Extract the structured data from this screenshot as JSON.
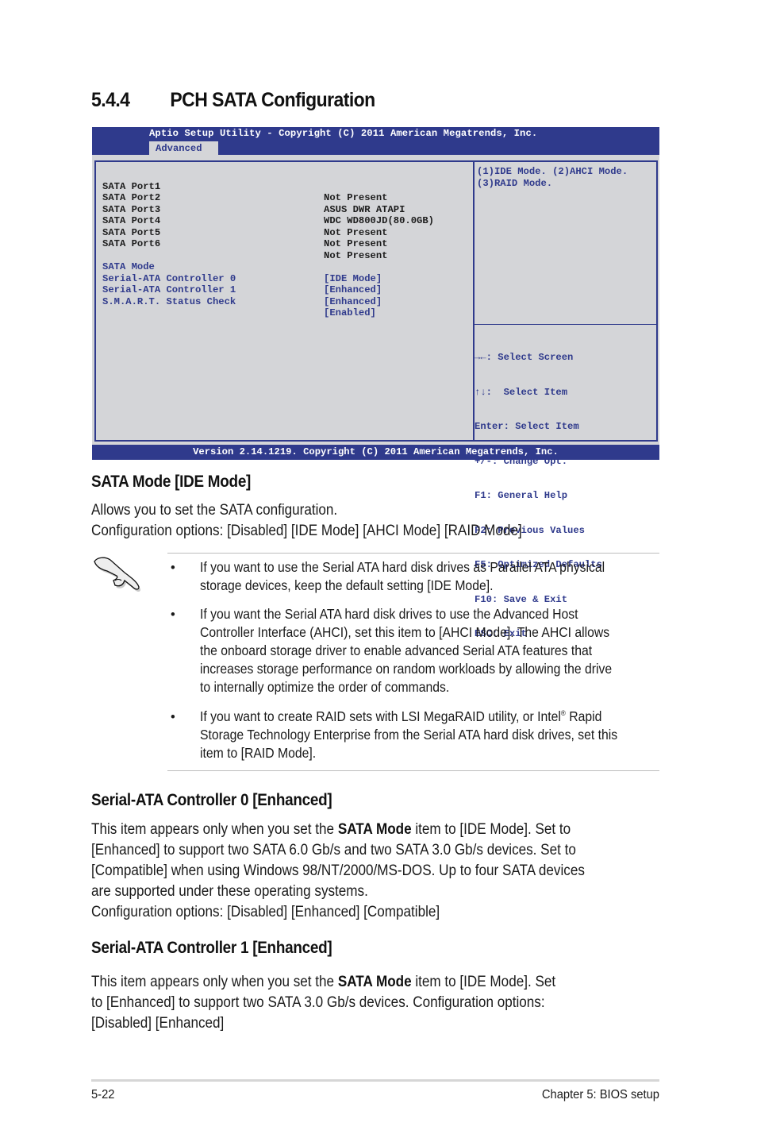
{
  "section": {
    "number": "5.4.4",
    "title": "PCH SATA Configuration"
  },
  "bios": {
    "title": "Aptio Setup Utility - Copyright (C) 2011 American Megatrends, Inc.",
    "active_tab": "Advanced",
    "info_rows": [
      {
        "label": "SATA Port1",
        "value": "Not Present"
      },
      {
        "label": "SATA Port2",
        "value": "ASUS DWR ATAPI"
      },
      {
        "label": "SATA Port3",
        "value": "WDC WD800JD(80.0GB)"
      },
      {
        "label": "SATA Port4",
        "value": "Not Present"
      },
      {
        "label": "SATA Port5",
        "value": "Not Present"
      },
      {
        "label": "SATA Port6",
        "value": "Not Present"
      }
    ],
    "config_rows": [
      {
        "label": "SATA Mode",
        "value": "[IDE Mode]"
      },
      {
        "label": "Serial-ATA Controller 0",
        "value": "[Enhanced]"
      },
      {
        "label": "Serial-ATA Controller 1",
        "value": "[Enhanced]"
      },
      {
        "label": "S.M.A.R.T. Status Check",
        "value": "[Enabled]"
      }
    ],
    "help_text": [
      "(1)IDE Mode. (2)AHCI Mode.",
      "(3)RAID Mode."
    ],
    "key_help": [
      "→←: Select Screen",
      "↑↓:  Select Item",
      "Enter: Select Item",
      "+/-: Change Opt.",
      "F1: General Help",
      "F2: Previous Values",
      "F5: Optimized Defaults",
      "F10: Save & Exit",
      "ESC: Exit"
    ],
    "footer": "Version 2.14.1219. Copyright (C) 2011 American Megatrends, Inc.",
    "colors": {
      "header_blue": "#2f3a8c",
      "panel_gray": "#d4d5d8",
      "info_text": "#1c1c1c"
    }
  },
  "sata_mode": {
    "heading": "SATA Mode [IDE Mode]",
    "lines": [
      "Allows you to set the SATA configuration.",
      "Configuration options: [Disabled] [IDE Mode] [AHCI Mode] [RAID Mode]"
    ]
  },
  "note": {
    "icon": "pointing-hand-icon",
    "bullet_char": "•",
    "bullets": [
      {
        "lines": [
          "If you want to use the Serial ATA hard disk drives as Parallel ATA physical",
          "storage devices, keep the default setting [IDE Mode]."
        ]
      },
      {
        "lines": [
          "If you want the Serial ATA hard disk drives to use the Advanced Host",
          "Controller Interface (AHCI), set this item to [AHCI Mode]. The AHCI allows",
          "the onboard storage driver to enable advanced Serial ATA features that",
          "increases storage performance on random workloads by allowing the drive",
          "to internally optimize the order of commands."
        ]
      },
      {
        "line1_before_sup": "If you want to create RAID sets with LSI MegaRAID utility, or Intel",
        "line1_sup": "®",
        "line1_after_sup": " Rapid",
        "lines_rest": [
          "Storage Technology Enterprise from the Serial ATA hard disk drives, set this",
          "item to [RAID Mode]."
        ]
      }
    ]
  },
  "controller0": {
    "heading": "Serial-ATA Controller 0 [Enhanced]",
    "line1_before": "This item appears only when you set the ",
    "line1_bold": "SATA Mode",
    "line1_after": " item to [IDE Mode]. Set to",
    "lines_rest": [
      "[Enhanced] to support two SATA 6.0 Gb/s and two SATA 3.0 Gb/s devices. Set to",
      "[Compatible] when using Windows 98/NT/2000/MS-DOS. Up to four SATA devices",
      "are supported under these operating systems.",
      "Configuration options: [Disabled] [Enhanced] [Compatible]"
    ]
  },
  "controller1": {
    "heading": "Serial-ATA Controller 1 [Enhanced]",
    "line1_before": "This item appears only when you set the ",
    "line1_bold": "SATA Mode",
    "line1_after": " item to [IDE Mode]. Set",
    "lines_rest": [
      "to [Enhanced] to support two SATA 3.0 Gb/s devices. Configuration options:",
      "[Disabled] [Enhanced]"
    ]
  },
  "page_footer": {
    "page_number": "5-22",
    "chapter": "Chapter 5: BIOS setup"
  }
}
